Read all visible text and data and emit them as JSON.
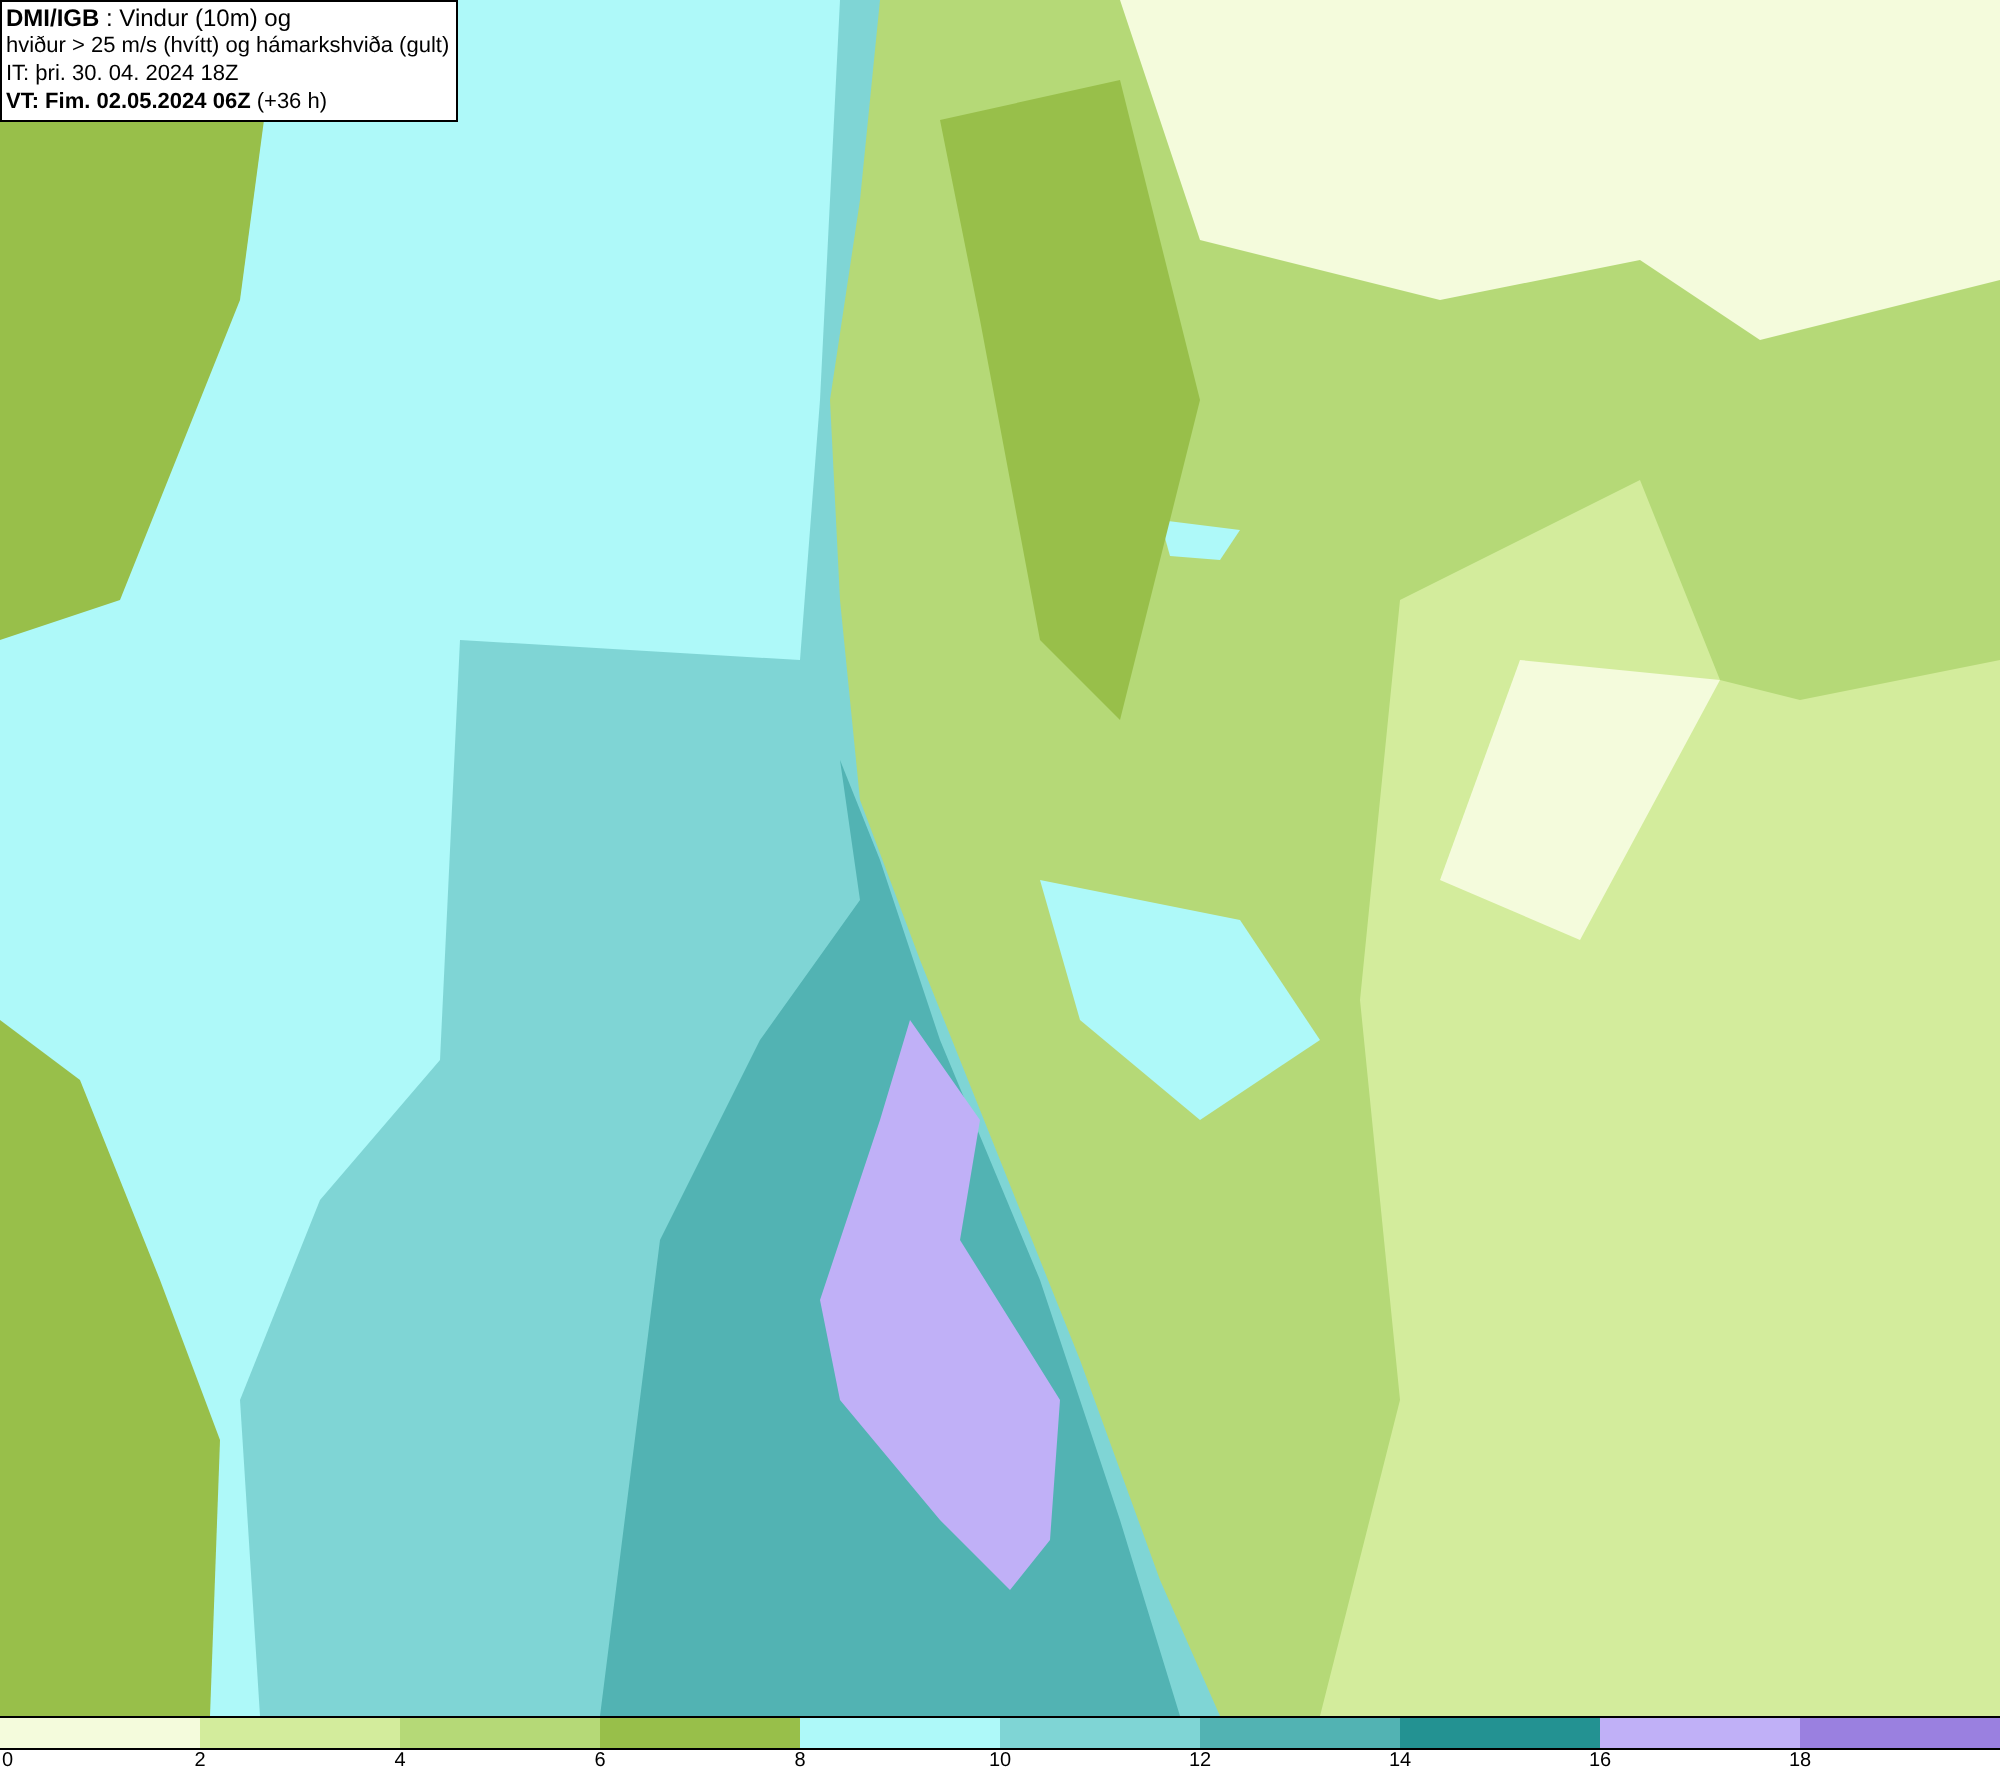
{
  "title_box": {
    "lines": [
      "**DMI/IGB** : Vindur (10m) og",
      "hviður > 25 m/s (hvítt) og hámarkshviða (gult)",
      "IT: þri. 30. 04. 2024 18Z",
      "**VT: Fim. 02.05.2024 06Z** (+36 h)"
    ]
  },
  "legend": [
    {
      "label": "0",
      "color": "#f4fbdc"
    },
    {
      "label": "2",
      "color": "#d3ec9c"
    },
    {
      "label": "4",
      "color": "#b5d977"
    },
    {
      "label": "6",
      "color": "#98bf4a"
    },
    {
      "label": "8",
      "color": "#aef9f9"
    },
    {
      "label": "10",
      "color": "#7fd5d5"
    },
    {
      "label": "12",
      "color": "#52b3b3"
    },
    {
      "label": "14",
      "color": "#239292"
    },
    {
      "label": "16",
      "color": "#c0b0f7"
    },
    {
      "label": "18",
      "color": "#9a80e0"
    }
  ]
}
